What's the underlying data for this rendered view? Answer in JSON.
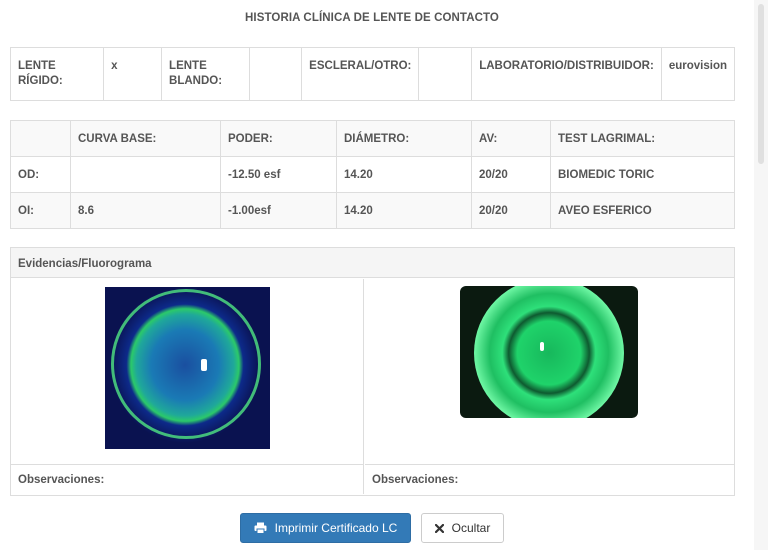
{
  "page": {
    "title": "HISTORIA CLÍNICA DE LENTE DE CONTACTO"
  },
  "lens_type": {
    "rigid_label": "LENTE RÍGIDO:",
    "rigid_value": "x",
    "soft_label": "LENTE BLANDO:",
    "soft_value": "",
    "scleral_label": "ESCLERAL/OTRO:",
    "scleral_value": "",
    "lab_label": "LABORATORIO/DISTRIBUIDOR:",
    "lab_value": "eurovision"
  },
  "measurements": {
    "headers": [
      "",
      "CURVA BASE:",
      "PODER:",
      "DIÁMETRO:",
      "AV:",
      "TEST LAGRIMAL:"
    ],
    "rows": [
      [
        "OD:",
        "",
        "-12.50 esf",
        "14.20",
        "20/20",
        "BIOMEDIC TORIC"
      ],
      [
        "OI:",
        "8.6",
        "-1.00esf",
        "14.20",
        "20/20",
        "AVEO ESFERICO"
      ]
    ]
  },
  "evidence": {
    "heading": "Evidencias/Fluorograma",
    "left_obs_label": "Observaciones:",
    "right_obs_label": "Observaciones:"
  },
  "buttons": {
    "print_label": "Imprimir Certificado LC",
    "hide_label": "Ocultar"
  },
  "colors": {
    "primary": "#337ab7",
    "border": "#dddddd"
  },
  "icons": {
    "print": "print-icon",
    "hide": "close-icon"
  }
}
